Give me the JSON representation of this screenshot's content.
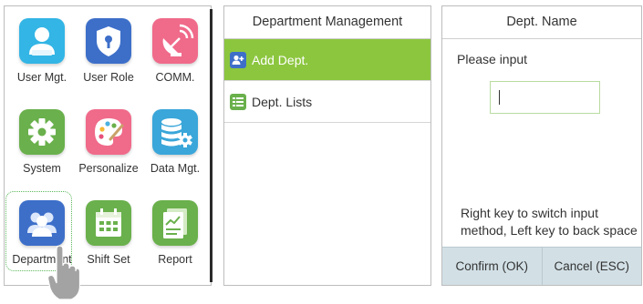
{
  "menu": {
    "items": [
      {
        "label": "User Mgt.",
        "icon": "user-icon",
        "color": "#33b5e5"
      },
      {
        "label": "User Role",
        "icon": "shield-icon",
        "color": "#3d6fc9"
      },
      {
        "label": "COMM.",
        "icon": "satellite-dish-icon",
        "color": "#f06a8a"
      },
      {
        "label": "System",
        "icon": "gear-icon",
        "color": "#6ab04c"
      },
      {
        "label": "Personalize",
        "icon": "palette-icon",
        "color": "#f06a8a"
      },
      {
        "label": "Data Mgt.",
        "icon": "database-gear-icon",
        "color": "#3aa6d9"
      },
      {
        "label": "Department",
        "icon": "people-icon",
        "color": "#3d6fc9",
        "selected": true
      },
      {
        "label": "Shift Set",
        "icon": "calendar-icon",
        "color": "#6ab04c"
      },
      {
        "label": "Report",
        "icon": "report-icon",
        "color": "#6ab04c"
      }
    ]
  },
  "dept_panel": {
    "title": "Department Management",
    "items": [
      {
        "label": "Add Dept.",
        "icon": "add-people-icon",
        "active": true
      },
      {
        "label": "Dept. Lists",
        "icon": "list-icon",
        "active": false
      }
    ]
  },
  "name_panel": {
    "title": "Dept. Name",
    "prompt": "Please input",
    "input_value": "",
    "hint": "Right key to switch input method, Left key to back space",
    "confirm_label": "Confirm (OK)",
    "cancel_label": "Cancel (ESC)"
  },
  "colors": {
    "accent_green": "#8cc63f",
    "footer_bg": "#d2e0e6"
  }
}
